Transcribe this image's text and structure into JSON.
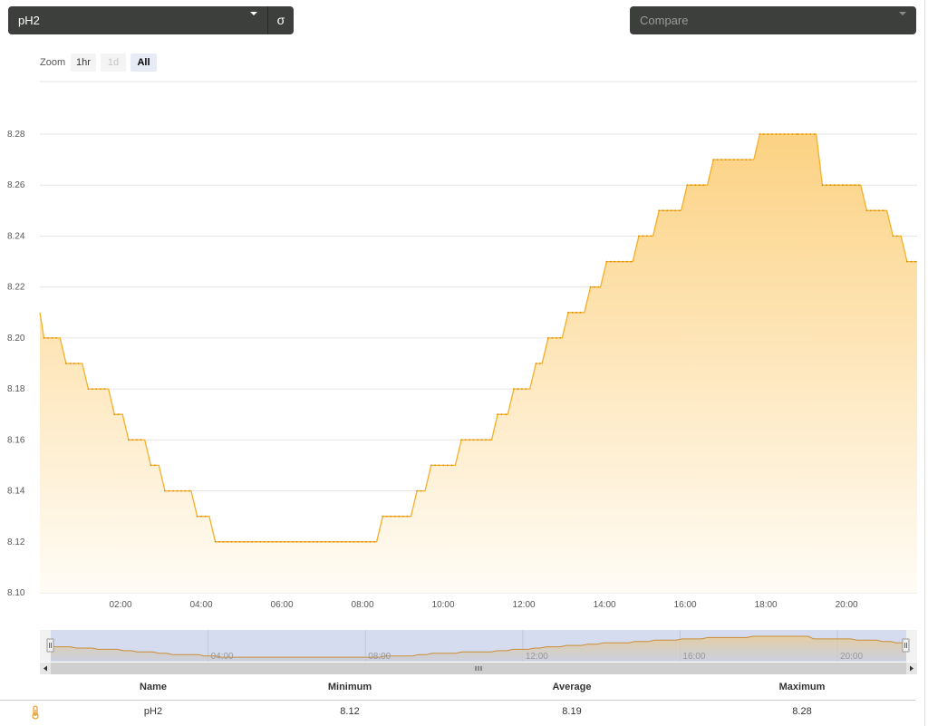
{
  "toolbar": {
    "series_value": "pH2",
    "sigma_label": "σ",
    "compare_placeholder": "Compare"
  },
  "zoom": {
    "label": "Zoom",
    "buttons": [
      "1hr",
      "1d",
      "All"
    ],
    "selected": "All"
  },
  "chart_data": {
    "type": "area",
    "step": true,
    "x_unit": "hours",
    "xlim": [
      0.0,
      21.75
    ],
    "ylim": [
      8.1,
      8.28
    ],
    "y_ticks": [
      "8.10",
      "8.12",
      "8.14",
      "8.16",
      "8.18",
      "8.20",
      "8.22",
      "8.24",
      "8.26",
      "8.28"
    ],
    "x_ticks": [
      "02:00",
      "04:00",
      "06:00",
      "08:00",
      "10:00",
      "12:00",
      "14:00",
      "16:00",
      "18:00",
      "20:00"
    ],
    "navigator_ticks": [
      "04:00",
      "08:00",
      "12:00",
      "16:00",
      "20:00"
    ],
    "grid": true,
    "series": [
      {
        "name": "pH2",
        "color": "#f5b027",
        "x": [
          0.0,
          0.1,
          0.5,
          0.65,
          1.05,
          1.2,
          1.7,
          1.85,
          2.05,
          2.2,
          2.6,
          2.75,
          2.95,
          3.1,
          3.75,
          3.9,
          4.2,
          4.35,
          8.35,
          8.5,
          9.2,
          9.35,
          9.55,
          9.7,
          10.3,
          10.45,
          11.2,
          11.35,
          11.6,
          11.75,
          12.15,
          12.3,
          12.45,
          12.6,
          12.95,
          13.1,
          13.5,
          13.65,
          13.9,
          14.05,
          14.7,
          14.85,
          15.2,
          15.35,
          15.9,
          16.05,
          16.55,
          16.7,
          17.7,
          17.85,
          18.8,
          19.25,
          19.4,
          20.35,
          20.5,
          21.0,
          21.15,
          21.35,
          21.5,
          21.75
        ],
        "y": [
          8.21,
          8.2,
          8.2,
          8.19,
          8.19,
          8.18,
          8.18,
          8.17,
          8.17,
          8.16,
          8.16,
          8.15,
          8.15,
          8.14,
          8.14,
          8.13,
          8.13,
          8.12,
          8.12,
          8.13,
          8.13,
          8.14,
          8.14,
          8.15,
          8.15,
          8.16,
          8.16,
          8.17,
          8.17,
          8.18,
          8.18,
          8.19,
          8.19,
          8.2,
          8.2,
          8.21,
          8.21,
          8.22,
          8.22,
          8.23,
          8.23,
          8.24,
          8.24,
          8.25,
          8.25,
          8.26,
          8.26,
          8.27,
          8.27,
          8.28,
          8.28,
          8.28,
          8.26,
          8.26,
          8.25,
          8.25,
          8.24,
          8.24,
          8.23,
          8.23
        ]
      }
    ]
  },
  "stats": {
    "headers": [
      "Name",
      "Minimum",
      "Average",
      "Maximum"
    ],
    "row": [
      "pH2",
      "8.12",
      "8.19",
      "8.28"
    ],
    "icon": "thermometer-icon"
  }
}
